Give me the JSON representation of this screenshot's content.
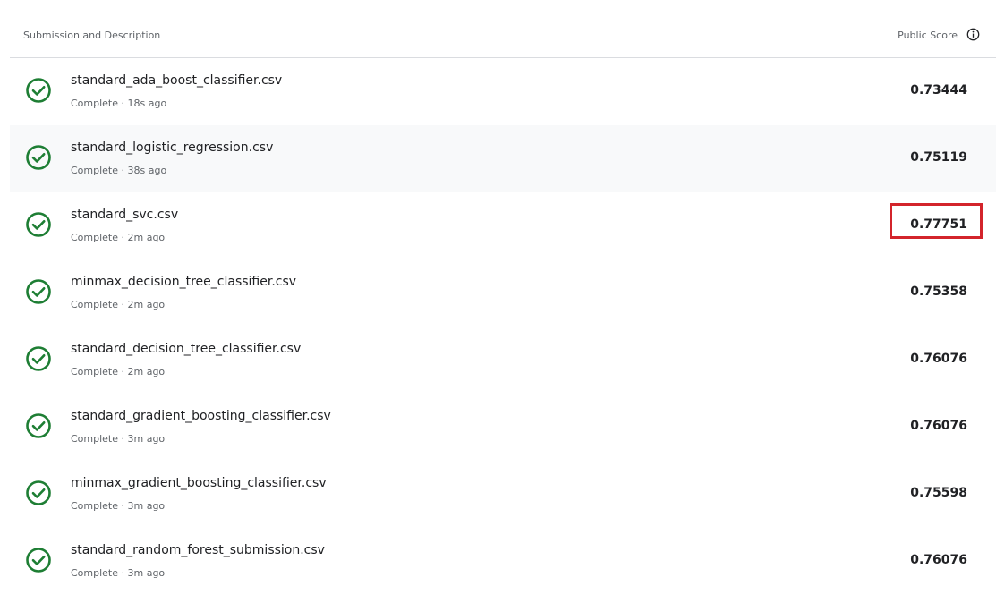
{
  "header": {
    "left_label": "Submission and Description",
    "right_label": "Public Score"
  },
  "colors": {
    "success": "#1e7e34",
    "highlight": "#d3242b"
  },
  "submissions": [
    {
      "file": "standard_ada_boost_classifier.csv",
      "status": "Complete · 18s ago",
      "score": "0.73444",
      "highlighted": false
    },
    {
      "file": "standard_logistic_regression.csv",
      "status": "Complete · 38s ago",
      "score": "0.75119",
      "highlighted": false
    },
    {
      "file": "standard_svc.csv",
      "status": "Complete · 2m ago",
      "score": "0.77751",
      "highlighted": true
    },
    {
      "file": "minmax_decision_tree_classifier.csv",
      "status": "Complete · 2m ago",
      "score": "0.75358",
      "highlighted": false
    },
    {
      "file": "standard_decision_tree_classifier.csv",
      "status": "Complete · 2m ago",
      "score": "0.76076",
      "highlighted": false
    },
    {
      "file": "standard_gradient_boosting_classifier.csv",
      "status": "Complete · 3m ago",
      "score": "0.76076",
      "highlighted": false
    },
    {
      "file": "minmax_gradient_boosting_classifier.csv",
      "status": "Complete · 3m ago",
      "score": "0.75598",
      "highlighted": false
    },
    {
      "file": "standard_random_forest_submission.csv",
      "status": "Complete · 3m ago",
      "score": "0.76076",
      "highlighted": false
    }
  ]
}
